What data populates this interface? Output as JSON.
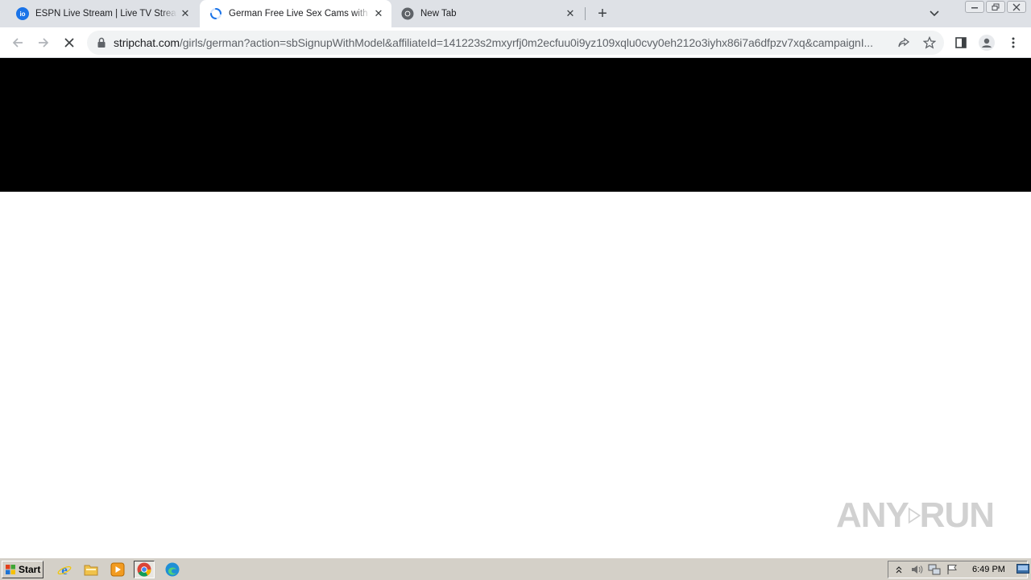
{
  "browser": {
    "tabs": [
      {
        "title": "ESPN Live Stream | Live TV Streams",
        "favicon": "io-logo-icon",
        "active": false,
        "loading": false
      },
      {
        "title": "German Free Live Sex Cams with Naked Girls",
        "favicon": "loading-spinner-icon",
        "active": true,
        "loading": true
      },
      {
        "title": "New Tab",
        "favicon": "chrome-icon",
        "active": false,
        "loading": false
      }
    ],
    "new_tab_symbol": "+",
    "omnibox": {
      "host": "stripchat.com",
      "path": "/girls/german?action=sbSignupWithModel&affiliateId=141223s2mxyrfj0m2ecfuu0i9yz109xqlu0cvy0eh212o3iyhx86i7a6dfpzv7xq&campaignI..."
    }
  },
  "page": {
    "watermark": {
      "left": "ANY",
      "right": "RUN"
    }
  },
  "taskbar": {
    "start_label": "Start",
    "clock": "6:49 PM"
  },
  "colors": {
    "tabstrip": "#dee1e6",
    "banner": "#000000",
    "taskbar": "#d4d0c8",
    "accent": "#1a73e8"
  }
}
